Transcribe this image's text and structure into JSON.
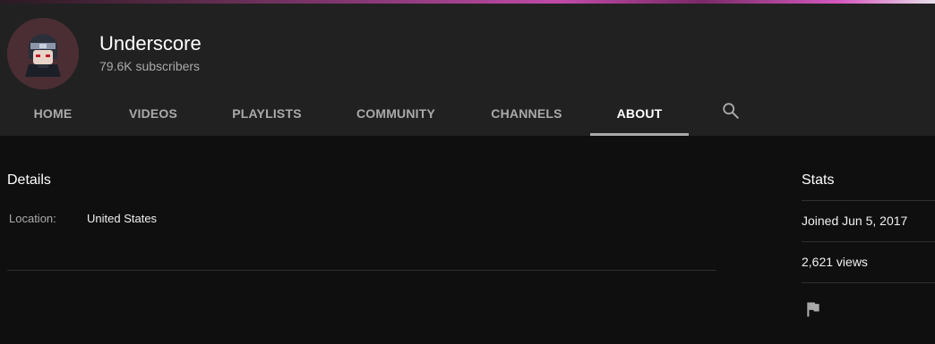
{
  "channel": {
    "name": "Underscore",
    "subscribers": "79.6K subscribers",
    "avatar_icon": "ninja-avatar-icon"
  },
  "tabs": [
    {
      "label": "HOME"
    },
    {
      "label": "VIDEOS"
    },
    {
      "label": "PLAYLISTS"
    },
    {
      "label": "COMMUNITY"
    },
    {
      "label": "CHANNELS"
    },
    {
      "label": "ABOUT"
    }
  ],
  "active_tab": "ABOUT",
  "details": {
    "title": "Details",
    "location_label": "Location:",
    "location_value": "United States"
  },
  "stats": {
    "title": "Stats",
    "joined": "Joined Jun 5, 2017",
    "views": "2,621 views"
  },
  "icons": {
    "search": "search-icon",
    "flag": "flag-icon"
  },
  "colors": {
    "background": "#0f0f0f",
    "header": "#212121",
    "text_primary": "#f1f1f1",
    "text_secondary": "#aaaaaa"
  }
}
